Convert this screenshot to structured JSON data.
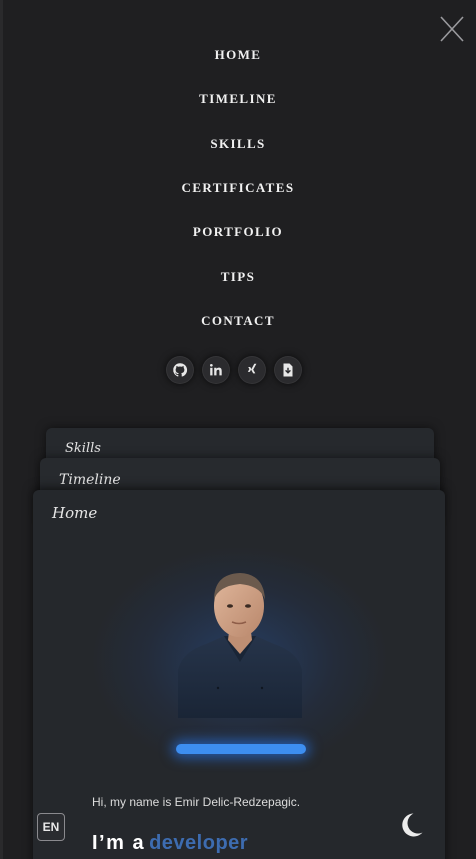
{
  "nav": {
    "items": [
      {
        "label": "HOME"
      },
      {
        "label": "TIMELINE"
      },
      {
        "label": "SKILLS"
      },
      {
        "label": "CERTIFICATES"
      },
      {
        "label": "PORTFOLIO"
      },
      {
        "label": "TIPS"
      },
      {
        "label": "CONTACT"
      }
    ]
  },
  "social": [
    "github-icon",
    "linkedin-icon",
    "xing-icon",
    "cv-download-icon"
  ],
  "cards": {
    "skills": "Skills",
    "timeline": "Timeline",
    "home": "Home"
  },
  "hero": {
    "intro": "Hi, my name is Emir Delic-Redzepagic.",
    "headline_prefix": "I’m a",
    "headline_role": "developer"
  },
  "controls": {
    "language": "EN",
    "theme_icon": "moon-icon"
  },
  "colors": {
    "background": "#1f1f21",
    "accent": "#3d6cb0",
    "glow": "#3d8ef0"
  }
}
